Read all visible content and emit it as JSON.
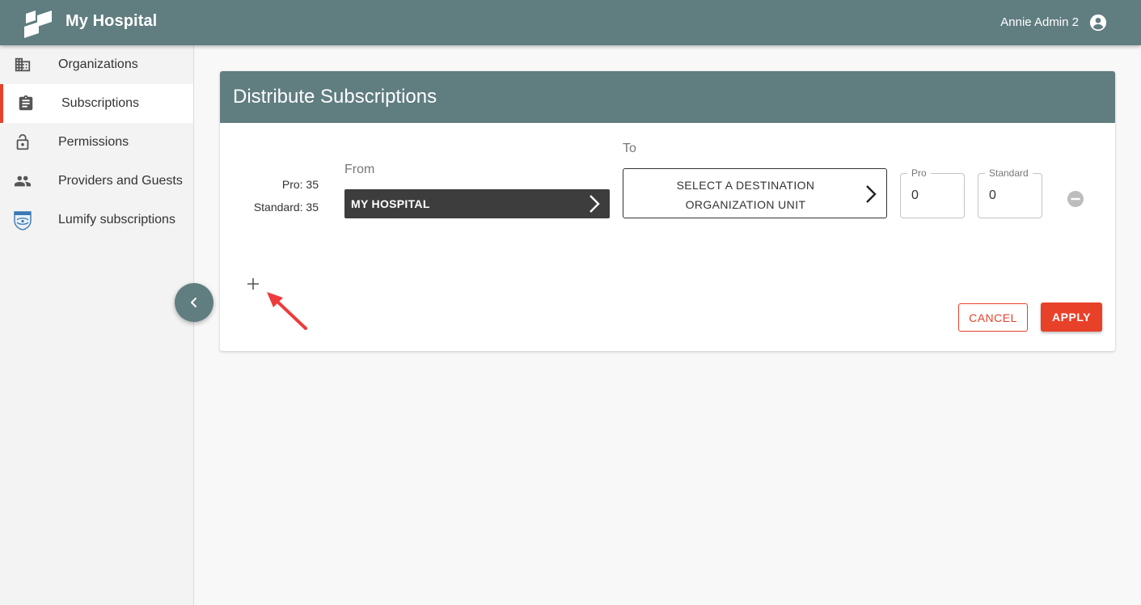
{
  "header": {
    "app_title": "My Hospital",
    "user_name": "Annie Admin 2",
    "logo_icon": "hospital-logo-icon",
    "user_icon": "account-circle-icon"
  },
  "sidebar": {
    "items": [
      {
        "label": "Organizations",
        "icon": "building-icon",
        "active": false
      },
      {
        "label": "Subscriptions",
        "icon": "clipboard-icon",
        "active": true
      },
      {
        "label": "Permissions",
        "icon": "lock-icon",
        "active": false
      },
      {
        "label": "Providers and Guests",
        "icon": "people-icon",
        "active": false
      },
      {
        "label": "Lumify subscriptions",
        "icon": "philips-shield-icon",
        "active": false
      }
    ],
    "collapse_icon": "chevron-left-icon"
  },
  "card": {
    "title": "Distribute Subscriptions",
    "available": {
      "pro": "Pro: 35",
      "standard": "Standard: 35"
    },
    "from_label": "From",
    "from_value": "MY HOSPITAL",
    "to_label": "To",
    "to_value": "SELECT A DESTINATION ORGANIZATION UNIT",
    "pro_field": {
      "label": "Pro",
      "value": "0"
    },
    "standard_field": {
      "label": "Standard",
      "value": "0"
    },
    "cancel_label": "CANCEL",
    "apply_label": "APPLY"
  },
  "colors": {
    "header_bg": "#607d80",
    "accent": "#e8412a",
    "from_bg": "#3d3d3d"
  }
}
